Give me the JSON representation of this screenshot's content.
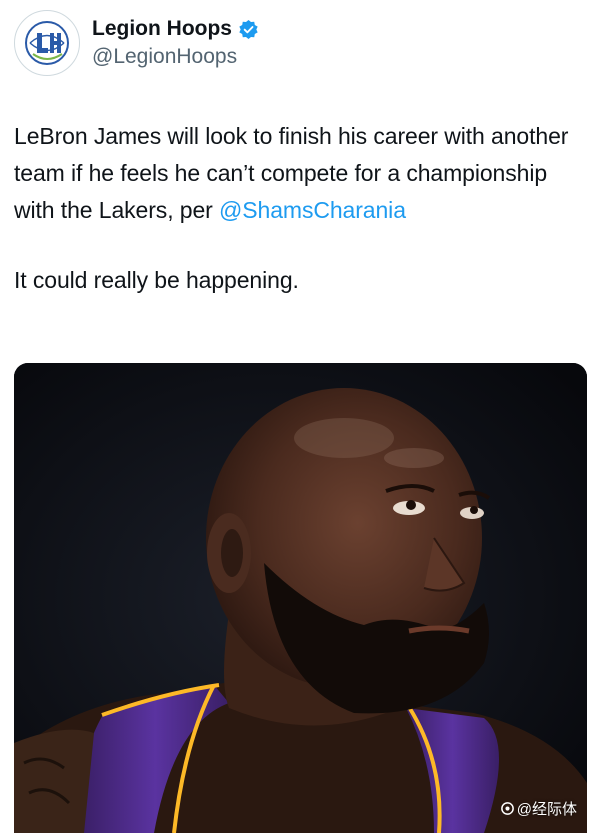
{
  "account": {
    "display_name": "Legion Hoops",
    "handle": "@LegionHoops",
    "avatar_letters": "LH",
    "verified_color": "#1d9bf0"
  },
  "tweet": {
    "line1_part1": "LeBron James will look to finish his career with another team if he feels he can’t compete for a championship with the Lakers, per ",
    "mention": "@ShamsCharania",
    "line2": "It could really be happening."
  },
  "media": {
    "watermark_text": "@经际体",
    "watermark_icon": "camera-icon"
  },
  "colors": {
    "mention": "#1d9bf0",
    "handle": "#536471",
    "jersey_purple": "#552583",
    "jersey_gold": "#fdb927"
  }
}
